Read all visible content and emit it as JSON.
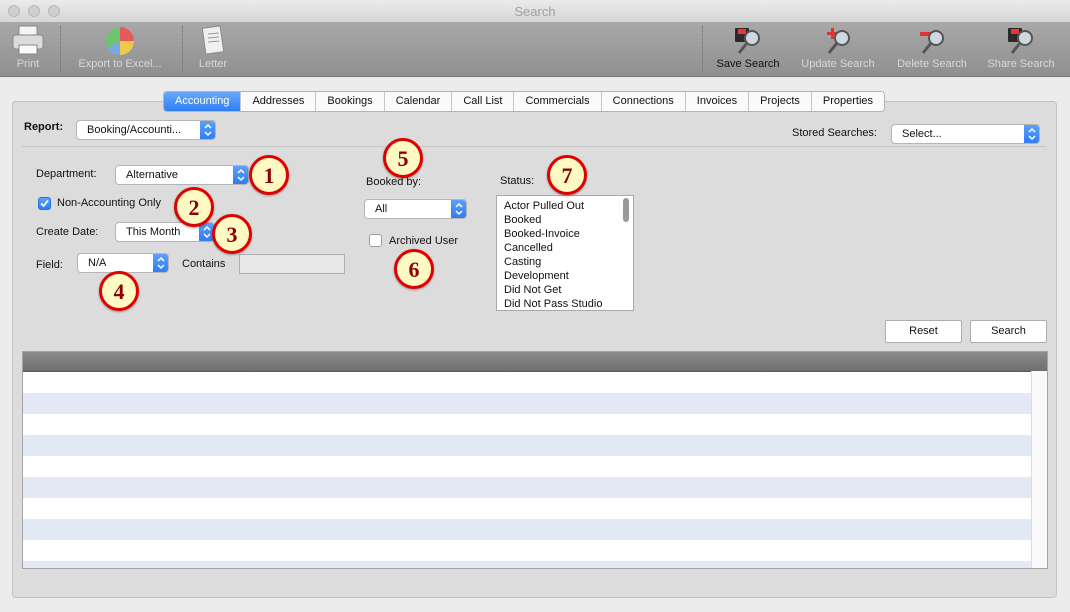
{
  "window": {
    "title": "Search"
  },
  "toolbar": {
    "print": "Print",
    "export": "Export to Excel...",
    "letter": "Letter",
    "save_search": "Save Search",
    "update_search": "Update Search",
    "delete_search": "Delete Search",
    "share_search": "Share Search"
  },
  "tabs": [
    "Accounting",
    "Addresses",
    "Bookings",
    "Calendar",
    "Call List",
    "Commercials",
    "Connections",
    "Invoices",
    "Projects",
    "Properties"
  ],
  "active_tab": "Accounting",
  "report": {
    "label": "Report:",
    "value": "Booking/Accounti..."
  },
  "stored_searches": {
    "label": "Stored Searches:",
    "value": "Select..."
  },
  "department": {
    "label": "Department:",
    "value": "Alternative"
  },
  "non_accounting_only": {
    "label": "Non-Accounting Only",
    "checked": true
  },
  "create_date": {
    "label": "Create Date:",
    "value": "This Month"
  },
  "field": {
    "label": "Field:",
    "value": "N/A",
    "contains_label": "Contains",
    "contains_value": ""
  },
  "booked_by": {
    "label": "Booked by:",
    "value": "All"
  },
  "archived_user": {
    "label": "Archived User",
    "checked": false
  },
  "status": {
    "label": "Status:",
    "items": [
      "Actor Pulled Out",
      "Booked",
      "Booked-Invoice",
      "Cancelled",
      "Casting",
      "Development",
      "Did Not Get",
      "Did Not Pass Studio"
    ]
  },
  "buttons": {
    "reset": "Reset",
    "search": "Search"
  },
  "badges": [
    "1",
    "2",
    "3",
    "4",
    "5",
    "6",
    "7"
  ],
  "colors": {
    "accent": "#2f7ef2",
    "badge_border": "#e10000",
    "badge_fill": "#fff9c4",
    "row_alt": "#e2e9f5"
  }
}
